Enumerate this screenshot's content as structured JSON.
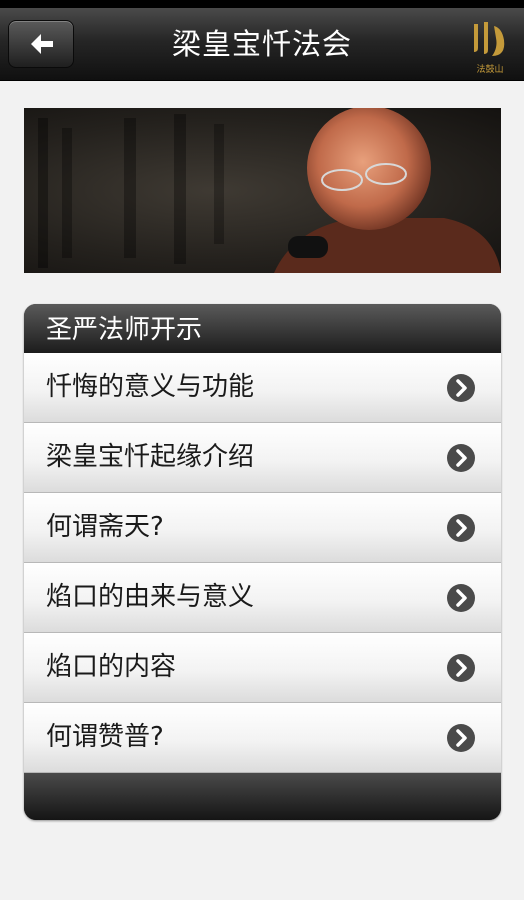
{
  "nav": {
    "title": "梁皇宝忏法会",
    "back": "back"
  },
  "logo": {
    "icon": "dharma-drum-logo",
    "caption": "法鼓山"
  },
  "banner": {
    "alt": "banner-photo"
  },
  "section": {
    "header": "圣严法师开示",
    "items": [
      {
        "label": "忏悔的意义与功能"
      },
      {
        "label": "梁皇宝忏起缘介绍"
      },
      {
        "label": "何谓斋天?"
      },
      {
        "label": "焰口的由来与意义"
      },
      {
        "label": "焰口的内容"
      },
      {
        "label": "何谓赞普?"
      }
    ]
  },
  "colors": {
    "accent": "#c49a3a",
    "bar": "#1c1c1c"
  }
}
